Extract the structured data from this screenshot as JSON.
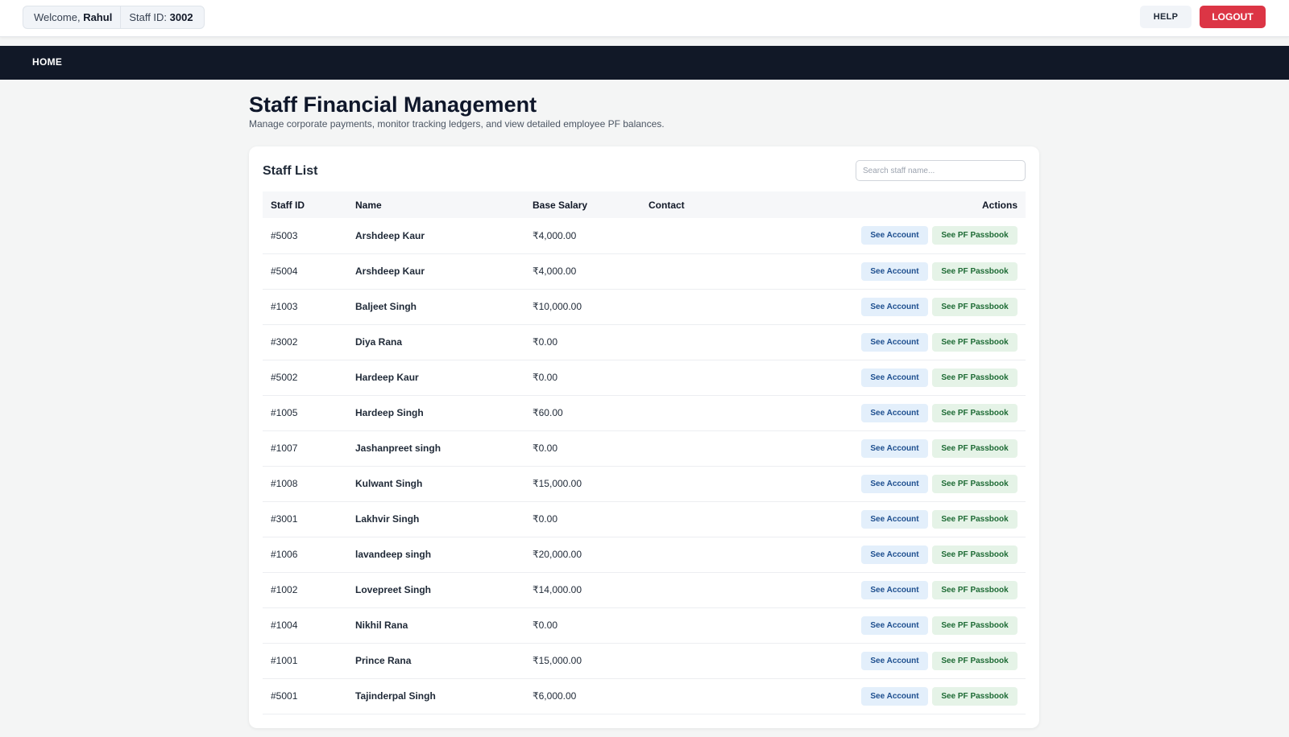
{
  "topbar": {
    "welcome_prefix": "Welcome,",
    "user_name": "Rahul",
    "staff_id_label": "Staff ID:",
    "staff_id_value": "3002",
    "help_label": "HELP",
    "logout_label": "LOGOUT",
    "logout_color": "#dc3545"
  },
  "nav": {
    "home_label": "HOME",
    "bar_color": "#111827"
  },
  "page": {
    "title": "Staff Financial Management",
    "subtitle": "Manage corporate payments, monitor tracking ledgers, and view detailed employee PF balances."
  },
  "staff_list": {
    "title": "Staff List",
    "search_placeholder": "Search staff name...",
    "columns": [
      "Staff ID",
      "Name",
      "Base Salary",
      "Contact",
      "Actions"
    ],
    "account_button_label": "See Account",
    "pf_button_label": "See PF Passbook",
    "rows": [
      {
        "id": "#5003",
        "name": "Arshdeep Kaur",
        "salary": "₹4,000.00",
        "contact": ""
      },
      {
        "id": "#5004",
        "name": "Arshdeep Kaur",
        "salary": "₹4,000.00",
        "contact": ""
      },
      {
        "id": "#1003",
        "name": "Baljeet Singh",
        "salary": "₹10,000.00",
        "contact": ""
      },
      {
        "id": "#3002",
        "name": "Diya Rana",
        "salary": "₹0.00",
        "contact": ""
      },
      {
        "id": "#5002",
        "name": "Hardeep Kaur",
        "salary": "₹0.00",
        "contact": ""
      },
      {
        "id": "#1005",
        "name": "Hardeep Singh",
        "salary": "₹60.00",
        "contact": ""
      },
      {
        "id": "#1007",
        "name": "Jashanpreet singh",
        "salary": "₹0.00",
        "contact": ""
      },
      {
        "id": "#1008",
        "name": "Kulwant Singh",
        "salary": "₹15,000.00",
        "contact": ""
      },
      {
        "id": "#3001",
        "name": "Lakhvir Singh",
        "salary": "₹0.00",
        "contact": ""
      },
      {
        "id": "#1006",
        "name": "lavandeep singh",
        "salary": "₹20,000.00",
        "contact": ""
      },
      {
        "id": "#1002",
        "name": "Lovepreet Singh",
        "salary": "₹14,000.00",
        "contact": ""
      },
      {
        "id": "#1004",
        "name": "Nikhil Rana",
        "salary": "₹0.00",
        "contact": ""
      },
      {
        "id": "#1001",
        "name": "Prince Rana",
        "salary": "₹15,000.00",
        "contact": ""
      },
      {
        "id": "#5001",
        "name": "Tajinderpal Singh",
        "salary": "₹6,000.00",
        "contact": ""
      }
    ]
  }
}
